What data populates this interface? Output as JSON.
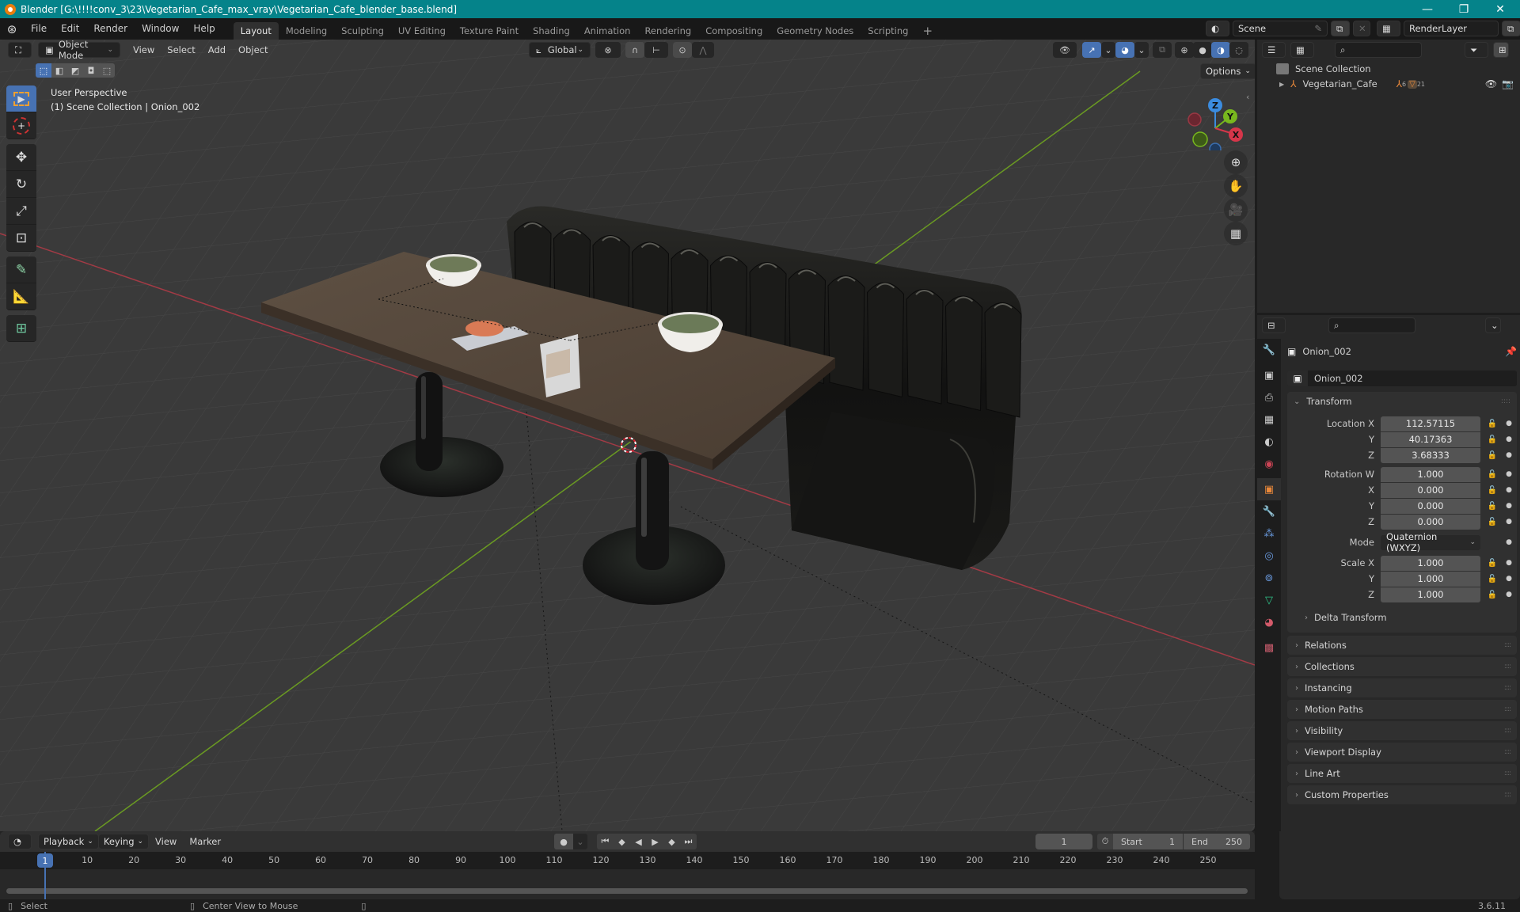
{
  "window": {
    "title": "Blender [G:\\!!!!conv_3\\23\\Vegetarian_Cafe_max_vray\\Vegetarian_Cafe_blender_base.blend]",
    "controls": {
      "minimize": "—",
      "maximize": "❐",
      "close": "✕"
    }
  },
  "menubar": {
    "menus": [
      "File",
      "Edit",
      "Render",
      "Window",
      "Help"
    ],
    "workspaces": [
      "Layout",
      "Modeling",
      "Sculpting",
      "UV Editing",
      "Texture Paint",
      "Shading",
      "Animation",
      "Rendering",
      "Compositing",
      "Geometry Nodes",
      "Scripting"
    ],
    "active_workspace": "Layout",
    "add_workspace": "+",
    "scene": "Scene",
    "view_layer": "RenderLayer"
  },
  "viewport": {
    "mode": "Object Mode",
    "menus": [
      "View",
      "Select",
      "Add",
      "Object"
    ],
    "orientation": "Global",
    "options_label": "Options",
    "overlay_info": {
      "view_name": "User Perspective",
      "collection_info": "(1) Scene Collection | Onion_002"
    },
    "gizmo_axes": {
      "x": "X",
      "y": "Y",
      "z": "Z"
    },
    "colors": {
      "x_axis": "#d6364a",
      "y_axis": "#78b81e",
      "z_axis": "#3b8ce0",
      "active_blue": "#4772b3"
    }
  },
  "toolbar": {
    "tools": [
      "select-box",
      "cursor",
      "move",
      "rotate",
      "scale",
      "transform",
      "annotate",
      "measure",
      "add-cube"
    ],
    "active_tool": "select-box"
  },
  "outliner": {
    "root": "Scene Collection",
    "items": [
      {
        "name": "Vegetarian_Cafe",
        "child_empty_count": "6",
        "child_mesh_count": "21"
      }
    ]
  },
  "properties": {
    "object_name": "Onion_002",
    "datablock_name": "Onion_002",
    "transform": {
      "title": "Transform",
      "location": {
        "label": "Location X",
        "x": "112.57115",
        "y": "40.17363",
        "z": "3.68333"
      },
      "rotation": {
        "label": "Rotation W",
        "w": "1.000",
        "x": "0.000",
        "y": "0.000",
        "z": "0.000"
      },
      "mode_label": "Mode",
      "mode_value": "Quaternion (WXYZ)",
      "scale": {
        "label": "Scale X",
        "x": "1.000",
        "y": "1.000",
        "z": "1.000"
      },
      "axis_labels": {
        "y": "Y",
        "z": "Z",
        "x": "X"
      },
      "delta": "Delta Transform"
    },
    "sections": [
      "Relations",
      "Collections",
      "Instancing",
      "Motion Paths",
      "Visibility",
      "Viewport Display",
      "Line Art",
      "Custom Properties"
    ]
  },
  "timeline": {
    "menus": [
      "Playback",
      "Keying",
      "View",
      "Marker"
    ],
    "current_frame": "1",
    "start_label": "Start",
    "start": "1",
    "end_label": "End",
    "end": "250",
    "ticks": [
      "10",
      "20",
      "30",
      "40",
      "50",
      "60",
      "70",
      "80",
      "90",
      "100",
      "110",
      "120",
      "130",
      "140",
      "150",
      "160",
      "170",
      "180",
      "190",
      "200",
      "210",
      "220",
      "230",
      "240",
      "250"
    ],
    "playhead": "1"
  },
  "statusbar": {
    "left_action": "Select",
    "middle_action": "Center View to Mouse",
    "version": "3.6.11"
  }
}
